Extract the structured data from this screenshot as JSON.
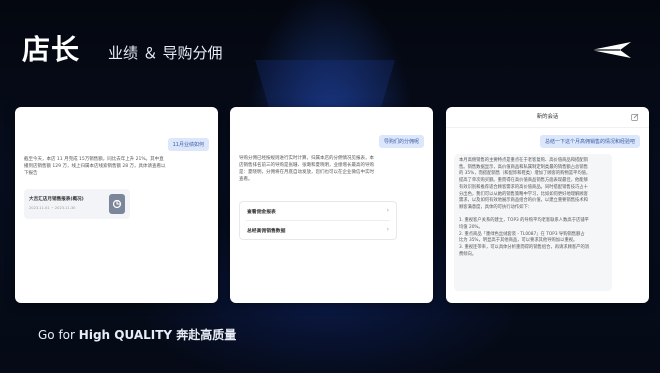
{
  "header": {
    "title": "店长",
    "subtitle": "业绩 ＆ 导购分佣"
  },
  "brand": {
    "logo_icon": "paper-plane-logo-icon"
  },
  "footer": {
    "slogan_go": "Go",
    "slogan_for": " for ",
    "slogan_high": "High QUALITY",
    "slogan_cn": " 奔赴高质量"
  },
  "cards": [
    {
      "user_query": "11月业绩如何",
      "answer_lines": [
        "截至今天，本店 11 月完成 15万销售额，同比去年上升 21%。其中直",
        "播到店销售额 129 万，线上归属本店线索销售额 28 万，具体请查看以",
        "下报告"
      ],
      "file": {
        "name": "大吉汇店月销售报表(概况)",
        "meta": "2023.11.01 ~ 2023.11.30",
        "icon": "document-icon"
      }
    },
    {
      "user_query": "导购们的分佣呢",
      "answer_lines": [
        "导购分佣已经按规则进行实时计算，归属本店的分佣情况见报表，本",
        "店销售排名前三的导购是张珊、张璐和夏晓明，业绩增长最高的导购",
        "是：夏晓明，分佣将在月底自动发放，您们也可以在企业微信中实时",
        "查看。"
      ],
      "links": [
        {
          "label": "查看佣金报表",
          "icon": "chevron-right-icon"
        },
        {
          "label": "总经高佣销售数据",
          "icon": "chevron-right-icon"
        }
      ]
    },
    {
      "header_title": "新的会话",
      "header_icon": "edit-icon",
      "user_query": "总结一下这个月高佣销售的情况和经验吧",
      "answer_lines": [
        "本月高佣销售的主要特点是重点在于老客复购、高价值商品和搭配销",
        "售。销售数据显示，高价值商品和私属制定制类最的销售额占总销售",
        "的 35%，而搭配销售（和配饰和鞋类）增加了顾客的购物篮平均值，",
        "提高了单次购买额。重而得在高价值商品销售方面表现最佳，他能够",
        "有效识别和推荐适合顾客需求的高价值商品。同时搭配销售技巧占十",
        "分出色，我们可以从她的销售策略中学习，比如如何更好地理解顾客",
        "需求，以及如何有效地展示商品组合的价值，以建立重要销售技术和",
        "顾客满意度，具体的可执行动作如下：",
        "",
        "1. 重视客户关系的建立，TOP3 的导购平均老客联系人数高于店铺平",
        "均值 20%。",
        "2. 重点商品「墨绿色丝绒套装 - TL0087」在 TOP3 导购销售额占",
        "比为 35%，明显高于其他商品，可以要求其他导购加以重视。",
        "3. 重视连带率，可以具体分析重而得的销售组合，再请求顾客产的消",
        "费倾向。"
      ]
    }
  ]
}
